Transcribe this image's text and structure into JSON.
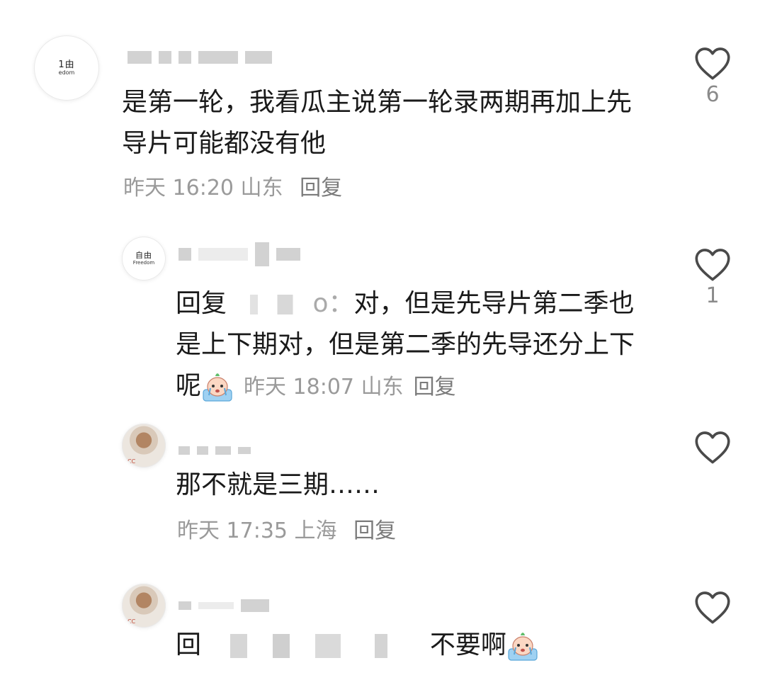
{
  "comments": [
    {
      "avatar": {
        "top": "1由",
        "bottom": "edom"
      },
      "text": "是第一轮，我看瓜主说第一轮录两期再加上先导片可能都没有他",
      "time": "昨天 16:20",
      "location": "山东",
      "reply_label": "回复",
      "likes": "6"
    },
    {
      "avatar": {
        "top": "自由",
        "bottom": "Freedom"
      },
      "reply_prefix": "回复",
      "reply_target_tail": "o：",
      "text": "对，但是先导片第二季也是上下期对，但是第二季的先导还分上下呢",
      "time": "昨天 18:07",
      "location": "山东",
      "reply_label": "回复",
      "likes": "1"
    },
    {
      "avatar": {
        "bottom": "CC"
      },
      "text": "那不就是三期……",
      "time": "昨天 17:35",
      "location": "上海",
      "reply_label": "回复"
    },
    {
      "avatar": {
        "bottom": "CC"
      },
      "reply_prefix": "回",
      "text": "不要啊"
    }
  ],
  "icons": {
    "like": "heart-outline-icon",
    "emoji": "crying-face-emoji"
  }
}
